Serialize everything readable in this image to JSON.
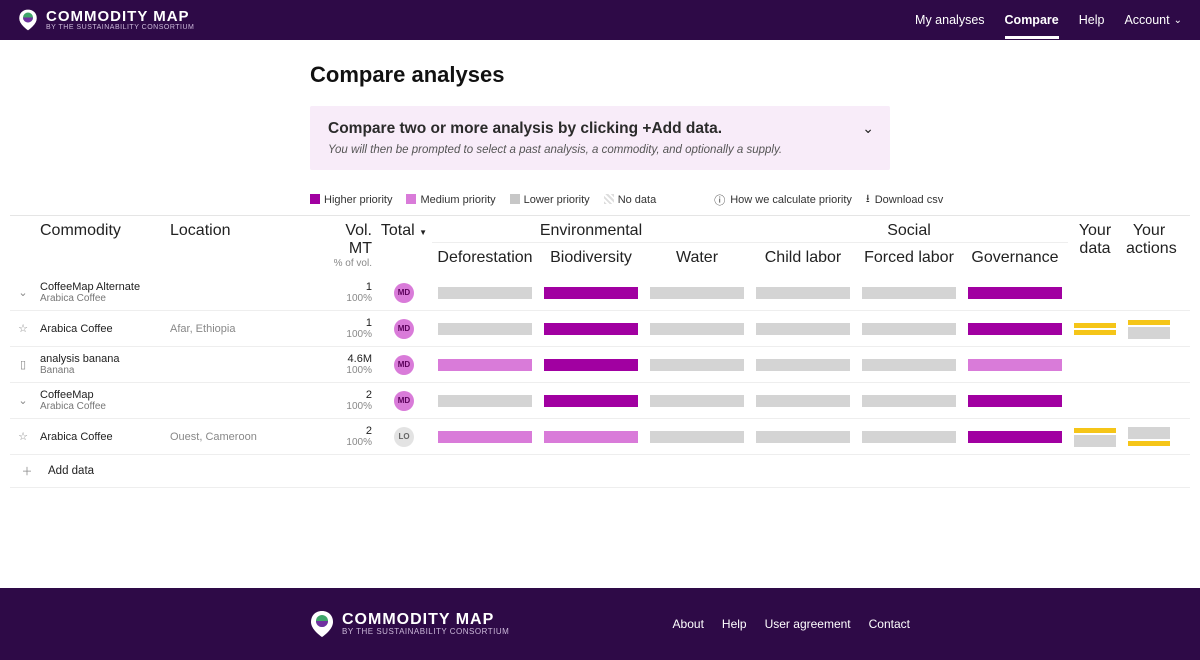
{
  "brand": {
    "title": "COMMODITY MAP",
    "subtitle": "BY THE SUSTAINABILITY CONSORTIUM"
  },
  "nav": {
    "my": "My analyses",
    "compare": "Compare",
    "help": "Help",
    "account": "Account"
  },
  "page": {
    "title": "Compare analyses"
  },
  "banner": {
    "title": "Compare two or more analysis by clicking +Add data.",
    "sub": "You will then be prompted to select a past analysis, a commodity, and optionally a supply."
  },
  "legend": {
    "hp": "Higher priority",
    "mp": "Medium priority",
    "lp": "Lower priority",
    "nd": "No data",
    "how": "How we calculate priority",
    "dl": "Download csv"
  },
  "columns": {
    "commodity": "Commodity",
    "location": "Location",
    "vol": "Vol. MT",
    "volsub": "% of vol.",
    "total": "Total",
    "env": "Environmental",
    "soc": "Social",
    "defor": "Deforestation",
    "bio": "Biodiversity",
    "water": "Water",
    "child": "Child labor",
    "forced": "Forced labor",
    "gov": "Governance",
    "yourdata": "Your data",
    "youractions": "Your actions"
  },
  "rows": [
    {
      "icon": "chev",
      "name": "CoffeeMap Alternate",
      "sub": "Arabica Coffee",
      "loc": "",
      "vol": "1",
      "pct": "100%",
      "badge": "MD",
      "bars": [
        "lp",
        "hp",
        "lp",
        "lp",
        "lp",
        "hp"
      ],
      "yd": [],
      "ya": []
    },
    {
      "icon": "star",
      "name": "Arabica Coffee",
      "sub": "",
      "loc": "Afar, Ethiopia",
      "vol": "1",
      "pct": "100%",
      "badge": "MD",
      "bars": [
        "lp",
        "hp",
        "lp",
        "lp",
        "lp",
        "hp"
      ],
      "yd": [
        "yd",
        "yd"
      ],
      "ya": [
        "yd",
        "lp"
      ]
    },
    {
      "icon": "doc",
      "name": "analysis banana",
      "sub": "Banana",
      "loc": "",
      "vol": "4.6M",
      "pct": "100%",
      "badge": "MD",
      "bars": [
        "mp",
        "hp",
        "lp",
        "lp",
        "lp",
        "mp"
      ],
      "yd": [],
      "ya": []
    },
    {
      "icon": "chev",
      "name": "CoffeeMap",
      "sub": "Arabica Coffee",
      "loc": "",
      "vol": "2",
      "pct": "100%",
      "badge": "MD",
      "bars": [
        "lp",
        "hp",
        "lp",
        "lp",
        "lp",
        "hp"
      ],
      "yd": [],
      "ya": []
    },
    {
      "icon": "star",
      "name": "Arabica Coffee",
      "sub": "",
      "loc": "Ouest, Cameroon",
      "vol": "2",
      "pct": "100%",
      "badge": "LO",
      "bars": [
        "mp",
        "mp",
        "lp",
        "lp",
        "lp",
        "hp"
      ],
      "yd": [
        "yd",
        "lp"
      ],
      "ya": [
        "lp",
        "yd"
      ]
    }
  ],
  "addrow": "Add data",
  "footer": {
    "about": "About",
    "help": "Help",
    "ua": "User agreement",
    "contact": "Contact"
  }
}
